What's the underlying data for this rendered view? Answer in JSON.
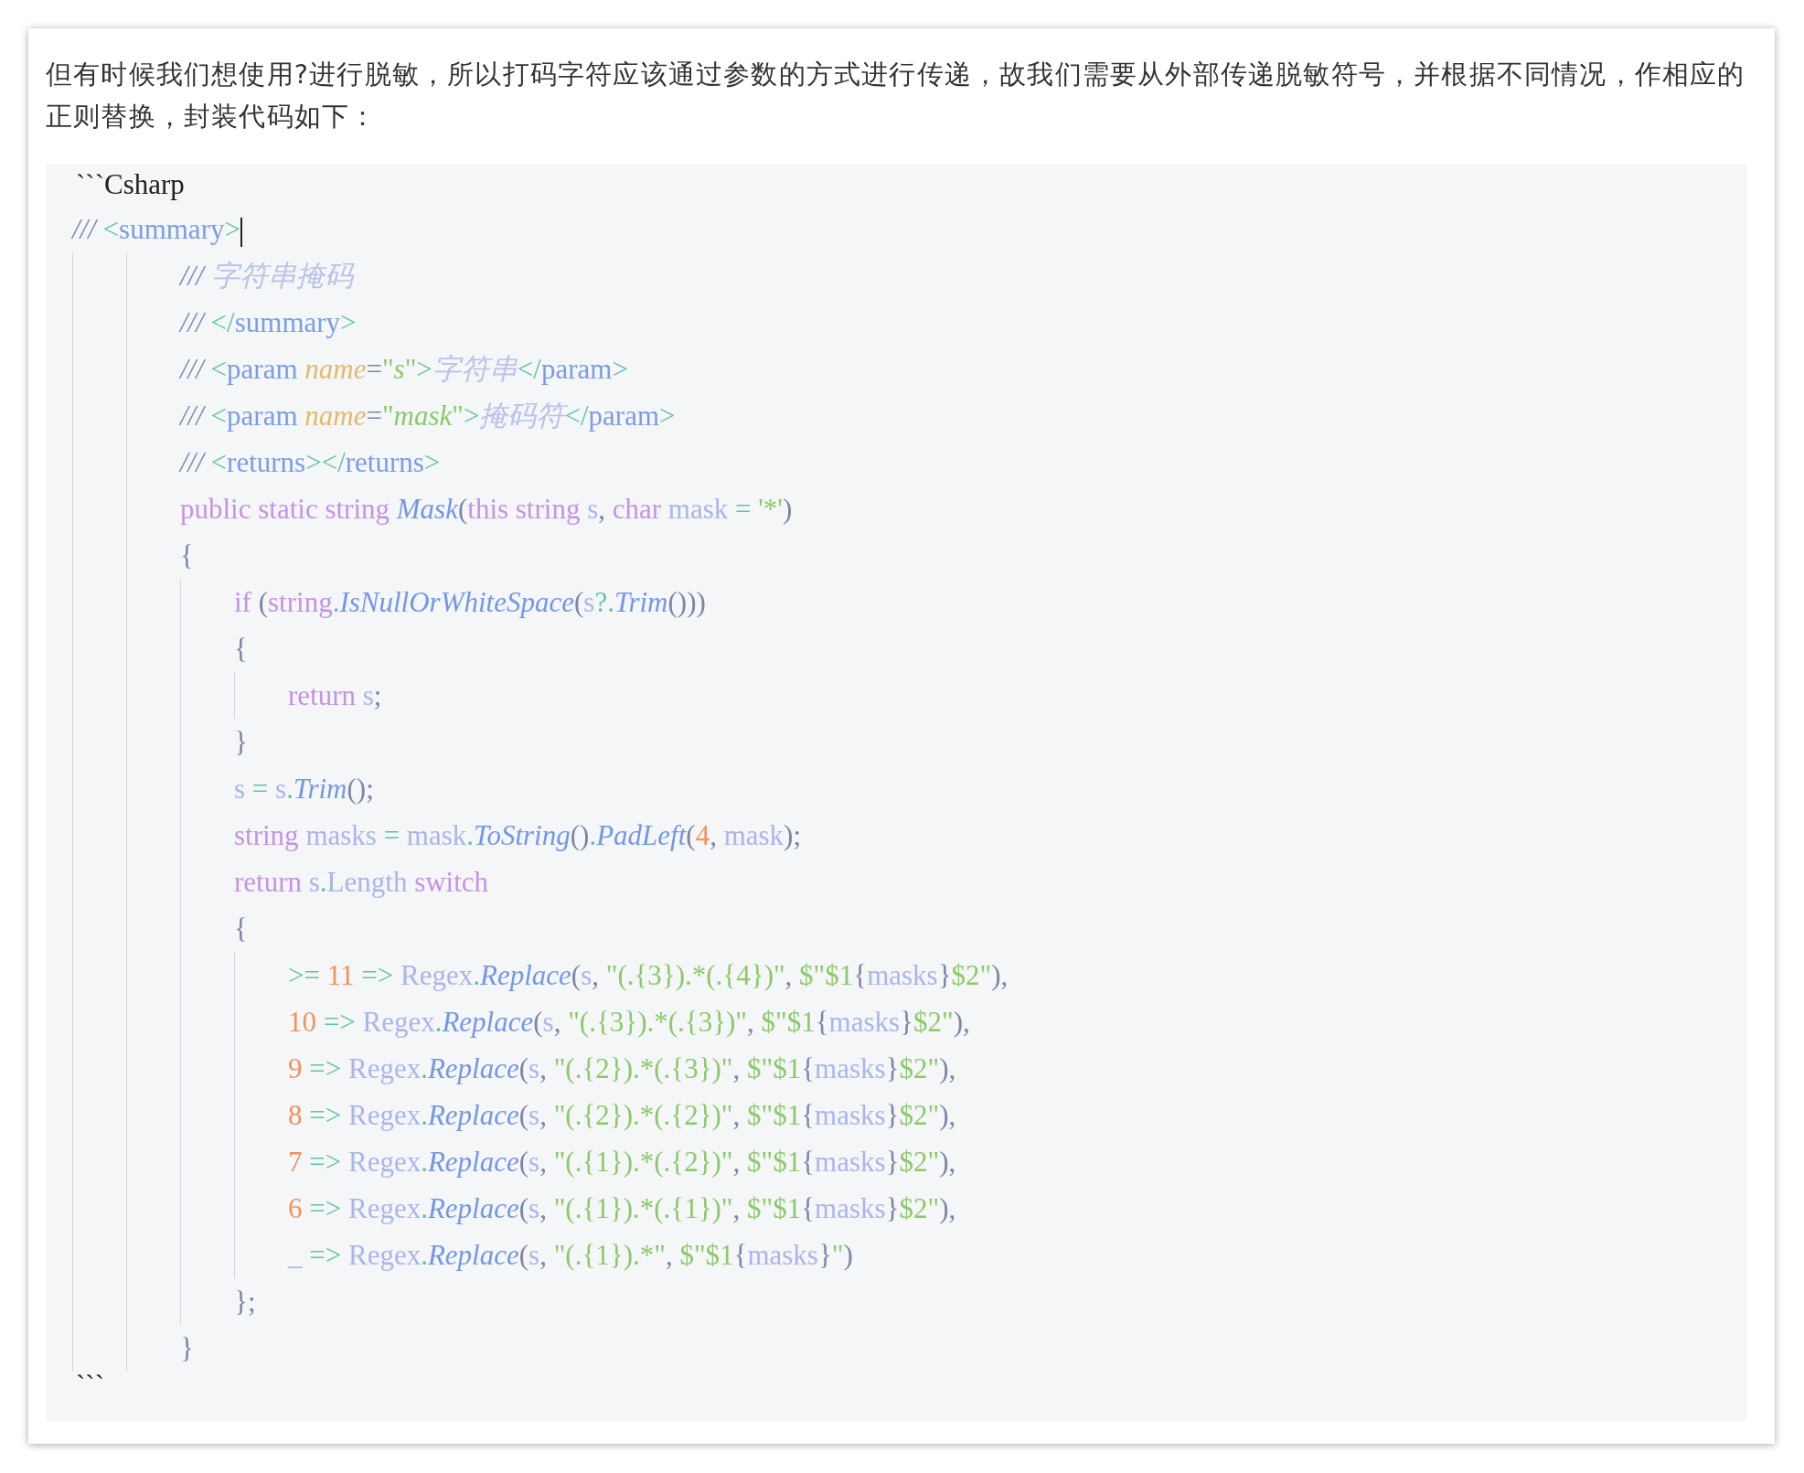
{
  "paragraph": "但有时候我们想使用?进行脱敏，所以打码字符应该通过参数的方式进行传递，故我们需要从外部传递脱敏符号，并根据不同情况，作相应的正则替换，封装代码如下：",
  "code_block": {
    "fence_open": "```Csharp",
    "fence_close": "```",
    "lines": [
      {
        "has_cursor": true,
        "tokens": [
          {
            "text": "/// ",
            "kind": "comment"
          },
          {
            "text": "<",
            "kind": "bracket"
          },
          {
            "text": "summary",
            "kind": "tag"
          },
          {
            "text": ">",
            "kind": "bracket"
          }
        ],
        "children": [
          {
            "children": [
              {
                "tokens": [
                  {
                    "text": "/// ",
                    "kind": "comment"
                  },
                  {
                    "text": "字符串掩码",
                    "kind": "doc"
                  }
                ]
              },
              {
                "tokens": [
                  {
                    "text": "/// ",
                    "kind": "comment"
                  },
                  {
                    "text": "</",
                    "kind": "bracket"
                  },
                  {
                    "text": "summary",
                    "kind": "tag"
                  },
                  {
                    "text": ">",
                    "kind": "bracket"
                  }
                ]
              },
              {
                "tokens": [
                  {
                    "text": "/// ",
                    "kind": "comment"
                  },
                  {
                    "text": "<",
                    "kind": "bracket"
                  },
                  {
                    "text": "param ",
                    "kind": "tag"
                  },
                  {
                    "text": "name",
                    "kind": "attr"
                  },
                  {
                    "text": "=",
                    "kind": "punct"
                  },
                  {
                    "text": "\"",
                    "kind": "string"
                  },
                  {
                    "text": "s",
                    "kind": "attrval"
                  },
                  {
                    "text": "\"",
                    "kind": "string"
                  },
                  {
                    "text": ">",
                    "kind": "bracket"
                  },
                  {
                    "text": "字符串",
                    "kind": "doc"
                  },
                  {
                    "text": "</",
                    "kind": "bracket"
                  },
                  {
                    "text": "param",
                    "kind": "tag"
                  },
                  {
                    "text": ">",
                    "kind": "bracket"
                  }
                ]
              },
              {
                "tokens": [
                  {
                    "text": "/// ",
                    "kind": "comment"
                  },
                  {
                    "text": "<",
                    "kind": "bracket"
                  },
                  {
                    "text": "param ",
                    "kind": "tag"
                  },
                  {
                    "text": "name",
                    "kind": "attr"
                  },
                  {
                    "text": "=",
                    "kind": "punct"
                  },
                  {
                    "text": "\"",
                    "kind": "string"
                  },
                  {
                    "text": "mask",
                    "kind": "attrval"
                  },
                  {
                    "text": "\"",
                    "kind": "string"
                  },
                  {
                    "text": ">",
                    "kind": "bracket"
                  },
                  {
                    "text": "掩码符",
                    "kind": "doc"
                  },
                  {
                    "text": "</",
                    "kind": "bracket"
                  },
                  {
                    "text": "param",
                    "kind": "tag"
                  },
                  {
                    "text": ">",
                    "kind": "bracket"
                  }
                ]
              },
              {
                "tokens": [
                  {
                    "text": "/// ",
                    "kind": "comment"
                  },
                  {
                    "text": "<",
                    "kind": "bracket"
                  },
                  {
                    "text": "returns",
                    "kind": "tag"
                  },
                  {
                    "text": "></",
                    "kind": "bracket"
                  },
                  {
                    "text": "returns",
                    "kind": "tag"
                  },
                  {
                    "text": ">",
                    "kind": "bracket"
                  }
                ]
              },
              {
                "tokens": [
                  {
                    "text": "public static string ",
                    "kind": "keyword"
                  },
                  {
                    "text": "Mask",
                    "kind": "method"
                  },
                  {
                    "text": "(",
                    "kind": "punct"
                  },
                  {
                    "text": "this string ",
                    "kind": "keyword"
                  },
                  {
                    "text": "s",
                    "kind": "var"
                  },
                  {
                    "text": ", ",
                    "kind": "punct"
                  },
                  {
                    "text": "char ",
                    "kind": "keyword"
                  },
                  {
                    "text": "mask",
                    "kind": "var"
                  },
                  {
                    "text": " = ",
                    "kind": "operator"
                  },
                  {
                    "text": "'*'",
                    "kind": "string"
                  },
                  {
                    "text": ")",
                    "kind": "punct"
                  }
                ]
              },
              {
                "tokens": [
                  {
                    "text": "{",
                    "kind": "punct"
                  }
                ],
                "children": [
                  {
                    "tokens": [
                      {
                        "text": "if ",
                        "kind": "keyword"
                      },
                      {
                        "text": "(",
                        "kind": "punct"
                      },
                      {
                        "text": "string",
                        "kind": "keyword"
                      },
                      {
                        "text": ".",
                        "kind": "operator"
                      },
                      {
                        "text": "IsNullOrWhiteSpace",
                        "kind": "method"
                      },
                      {
                        "text": "(",
                        "kind": "punct"
                      },
                      {
                        "text": "s",
                        "kind": "var"
                      },
                      {
                        "text": "?.",
                        "kind": "operator"
                      },
                      {
                        "text": "Trim",
                        "kind": "method"
                      },
                      {
                        "text": "()))",
                        "kind": "punct"
                      }
                    ]
                  },
                  {
                    "tokens": [
                      {
                        "text": "{",
                        "kind": "punct"
                      }
                    ],
                    "children": [
                      {
                        "tokens": [
                          {
                            "text": "return ",
                            "kind": "keyword"
                          },
                          {
                            "text": "s",
                            "kind": "var"
                          },
                          {
                            "text": ";",
                            "kind": "punct"
                          }
                        ]
                      }
                    ]
                  },
                  {
                    "tokens": [
                      {
                        "text": "}",
                        "kind": "punct"
                      }
                    ]
                  },
                  {
                    "tokens": [
                      {
                        "text": "s",
                        "kind": "var"
                      },
                      {
                        "text": " = ",
                        "kind": "operator"
                      },
                      {
                        "text": "s",
                        "kind": "var"
                      },
                      {
                        "text": ".",
                        "kind": "operator"
                      },
                      {
                        "text": "Trim",
                        "kind": "method"
                      },
                      {
                        "text": "();",
                        "kind": "punct"
                      }
                    ]
                  },
                  {
                    "tokens": [
                      {
                        "text": "string ",
                        "kind": "keyword"
                      },
                      {
                        "text": "masks",
                        "kind": "var"
                      },
                      {
                        "text": " = ",
                        "kind": "operator"
                      },
                      {
                        "text": "mask",
                        "kind": "var"
                      },
                      {
                        "text": ".",
                        "kind": "operator"
                      },
                      {
                        "text": "ToString",
                        "kind": "method"
                      },
                      {
                        "text": "()",
                        "kind": "punct"
                      },
                      {
                        "text": ".",
                        "kind": "operator"
                      },
                      {
                        "text": "PadLeft",
                        "kind": "method"
                      },
                      {
                        "text": "(",
                        "kind": "punct"
                      },
                      {
                        "text": "4",
                        "kind": "number"
                      },
                      {
                        "text": ", ",
                        "kind": "punct"
                      },
                      {
                        "text": "mask",
                        "kind": "var"
                      },
                      {
                        "text": ");",
                        "kind": "punct"
                      }
                    ]
                  },
                  {
                    "tokens": [
                      {
                        "text": "return ",
                        "kind": "keyword"
                      },
                      {
                        "text": "s",
                        "kind": "var"
                      },
                      {
                        "text": ".",
                        "kind": "operator"
                      },
                      {
                        "text": "Length",
                        "kind": "var"
                      },
                      {
                        "text": " switch",
                        "kind": "keyword"
                      }
                    ]
                  },
                  {
                    "tokens": [
                      {
                        "text": "{",
                        "kind": "punct"
                      }
                    ],
                    "children": [
                      {
                        "tokens": [
                          {
                            "text": ">= ",
                            "kind": "operator"
                          },
                          {
                            "text": "11",
                            "kind": "number"
                          },
                          {
                            "text": " => ",
                            "kind": "operator"
                          },
                          {
                            "text": "Regex",
                            "kind": "var"
                          },
                          {
                            "text": ".",
                            "kind": "operator"
                          },
                          {
                            "text": "Replace",
                            "kind": "method"
                          },
                          {
                            "text": "(",
                            "kind": "punct"
                          },
                          {
                            "text": "s",
                            "kind": "var"
                          },
                          {
                            "text": ", ",
                            "kind": "punct"
                          },
                          {
                            "text": "\"(.{3}).*(.{4})\"",
                            "kind": "string"
                          },
                          {
                            "text": ", ",
                            "kind": "punct"
                          },
                          {
                            "text": "$\"$1",
                            "kind": "string"
                          },
                          {
                            "text": "{",
                            "kind": "punct"
                          },
                          {
                            "text": "masks",
                            "kind": "var"
                          },
                          {
                            "text": "}",
                            "kind": "punct"
                          },
                          {
                            "text": "$2\"",
                            "kind": "string"
                          },
                          {
                            "text": "),",
                            "kind": "punct"
                          }
                        ]
                      },
                      {
                        "tokens": [
                          {
                            "text": "10",
                            "kind": "number"
                          },
                          {
                            "text": " => ",
                            "kind": "operator"
                          },
                          {
                            "text": "Regex",
                            "kind": "var"
                          },
                          {
                            "text": ".",
                            "kind": "operator"
                          },
                          {
                            "text": "Replace",
                            "kind": "method"
                          },
                          {
                            "text": "(",
                            "kind": "punct"
                          },
                          {
                            "text": "s",
                            "kind": "var"
                          },
                          {
                            "text": ", ",
                            "kind": "punct"
                          },
                          {
                            "text": "\"(.{3}).*(.{3})\"",
                            "kind": "string"
                          },
                          {
                            "text": ", ",
                            "kind": "punct"
                          },
                          {
                            "text": "$\"$1",
                            "kind": "string"
                          },
                          {
                            "text": "{",
                            "kind": "punct"
                          },
                          {
                            "text": "masks",
                            "kind": "var"
                          },
                          {
                            "text": "}",
                            "kind": "punct"
                          },
                          {
                            "text": "$2\"",
                            "kind": "string"
                          },
                          {
                            "text": "),",
                            "kind": "punct"
                          }
                        ]
                      },
                      {
                        "tokens": [
                          {
                            "text": "9",
                            "kind": "number"
                          },
                          {
                            "text": " => ",
                            "kind": "operator"
                          },
                          {
                            "text": "Regex",
                            "kind": "var"
                          },
                          {
                            "text": ".",
                            "kind": "operator"
                          },
                          {
                            "text": "Replace",
                            "kind": "method"
                          },
                          {
                            "text": "(",
                            "kind": "punct"
                          },
                          {
                            "text": "s",
                            "kind": "var"
                          },
                          {
                            "text": ", ",
                            "kind": "punct"
                          },
                          {
                            "text": "\"(.{2}).*(.{3})\"",
                            "kind": "string"
                          },
                          {
                            "text": ", ",
                            "kind": "punct"
                          },
                          {
                            "text": "$\"$1",
                            "kind": "string"
                          },
                          {
                            "text": "{",
                            "kind": "punct"
                          },
                          {
                            "text": "masks",
                            "kind": "var"
                          },
                          {
                            "text": "}",
                            "kind": "punct"
                          },
                          {
                            "text": "$2\"",
                            "kind": "string"
                          },
                          {
                            "text": "),",
                            "kind": "punct"
                          }
                        ]
                      },
                      {
                        "tokens": [
                          {
                            "text": "8",
                            "kind": "number"
                          },
                          {
                            "text": " => ",
                            "kind": "operator"
                          },
                          {
                            "text": "Regex",
                            "kind": "var"
                          },
                          {
                            "text": ".",
                            "kind": "operator"
                          },
                          {
                            "text": "Replace",
                            "kind": "method"
                          },
                          {
                            "text": "(",
                            "kind": "punct"
                          },
                          {
                            "text": "s",
                            "kind": "var"
                          },
                          {
                            "text": ", ",
                            "kind": "punct"
                          },
                          {
                            "text": "\"(.{2}).*(.{2})\"",
                            "kind": "string"
                          },
                          {
                            "text": ", ",
                            "kind": "punct"
                          },
                          {
                            "text": "$\"$1",
                            "kind": "string"
                          },
                          {
                            "text": "{",
                            "kind": "punct"
                          },
                          {
                            "text": "masks",
                            "kind": "var"
                          },
                          {
                            "text": "}",
                            "kind": "punct"
                          },
                          {
                            "text": "$2\"",
                            "kind": "string"
                          },
                          {
                            "text": "),",
                            "kind": "punct"
                          }
                        ]
                      },
                      {
                        "tokens": [
                          {
                            "text": "7",
                            "kind": "number"
                          },
                          {
                            "text": " => ",
                            "kind": "operator"
                          },
                          {
                            "text": "Regex",
                            "kind": "var"
                          },
                          {
                            "text": ".",
                            "kind": "operator"
                          },
                          {
                            "text": "Replace",
                            "kind": "method"
                          },
                          {
                            "text": "(",
                            "kind": "punct"
                          },
                          {
                            "text": "s",
                            "kind": "var"
                          },
                          {
                            "text": ", ",
                            "kind": "punct"
                          },
                          {
                            "text": "\"(.{1}).*(.{2})\"",
                            "kind": "string"
                          },
                          {
                            "text": ", ",
                            "kind": "punct"
                          },
                          {
                            "text": "$\"$1",
                            "kind": "string"
                          },
                          {
                            "text": "{",
                            "kind": "punct"
                          },
                          {
                            "text": "masks",
                            "kind": "var"
                          },
                          {
                            "text": "}",
                            "kind": "punct"
                          },
                          {
                            "text": "$2\"",
                            "kind": "string"
                          },
                          {
                            "text": "),",
                            "kind": "punct"
                          }
                        ]
                      },
                      {
                        "tokens": [
                          {
                            "text": "6",
                            "kind": "number"
                          },
                          {
                            "text": " => ",
                            "kind": "operator"
                          },
                          {
                            "text": "Regex",
                            "kind": "var"
                          },
                          {
                            "text": ".",
                            "kind": "operator"
                          },
                          {
                            "text": "Replace",
                            "kind": "method"
                          },
                          {
                            "text": "(",
                            "kind": "punct"
                          },
                          {
                            "text": "s",
                            "kind": "var"
                          },
                          {
                            "text": ", ",
                            "kind": "punct"
                          },
                          {
                            "text": "\"(.{1}).*(.{1})\"",
                            "kind": "string"
                          },
                          {
                            "text": ", ",
                            "kind": "punct"
                          },
                          {
                            "text": "$\"$1",
                            "kind": "string"
                          },
                          {
                            "text": "{",
                            "kind": "punct"
                          },
                          {
                            "text": "masks",
                            "kind": "var"
                          },
                          {
                            "text": "}",
                            "kind": "punct"
                          },
                          {
                            "text": "$2\"",
                            "kind": "string"
                          },
                          {
                            "text": "),",
                            "kind": "punct"
                          }
                        ]
                      },
                      {
                        "tokens": [
                          {
                            "text": "_",
                            "kind": "var"
                          },
                          {
                            "text": " => ",
                            "kind": "operator"
                          },
                          {
                            "text": "Regex",
                            "kind": "var"
                          },
                          {
                            "text": ".",
                            "kind": "operator"
                          },
                          {
                            "text": "Replace",
                            "kind": "method"
                          },
                          {
                            "text": "(",
                            "kind": "punct"
                          },
                          {
                            "text": "s",
                            "kind": "var"
                          },
                          {
                            "text": ", ",
                            "kind": "punct"
                          },
                          {
                            "text": "\"(.{1}).*\"",
                            "kind": "string"
                          },
                          {
                            "text": ", ",
                            "kind": "punct"
                          },
                          {
                            "text": "$\"$1",
                            "kind": "string"
                          },
                          {
                            "text": "{",
                            "kind": "punct"
                          },
                          {
                            "text": "masks",
                            "kind": "var"
                          },
                          {
                            "text": "}",
                            "kind": "punct"
                          },
                          {
                            "text": "\"",
                            "kind": "string"
                          },
                          {
                            "text": ")",
                            "kind": "punct"
                          }
                        ]
                      }
                    ]
                  },
                  {
                    "tokens": [
                      {
                        "text": "};",
                        "kind": "punct"
                      }
                    ]
                  }
                ]
              },
              {
                "tokens": [
                  {
                    "text": "}",
                    "kind": "punct"
                  }
                ]
              }
            ]
          }
        ]
      }
    ]
  }
}
